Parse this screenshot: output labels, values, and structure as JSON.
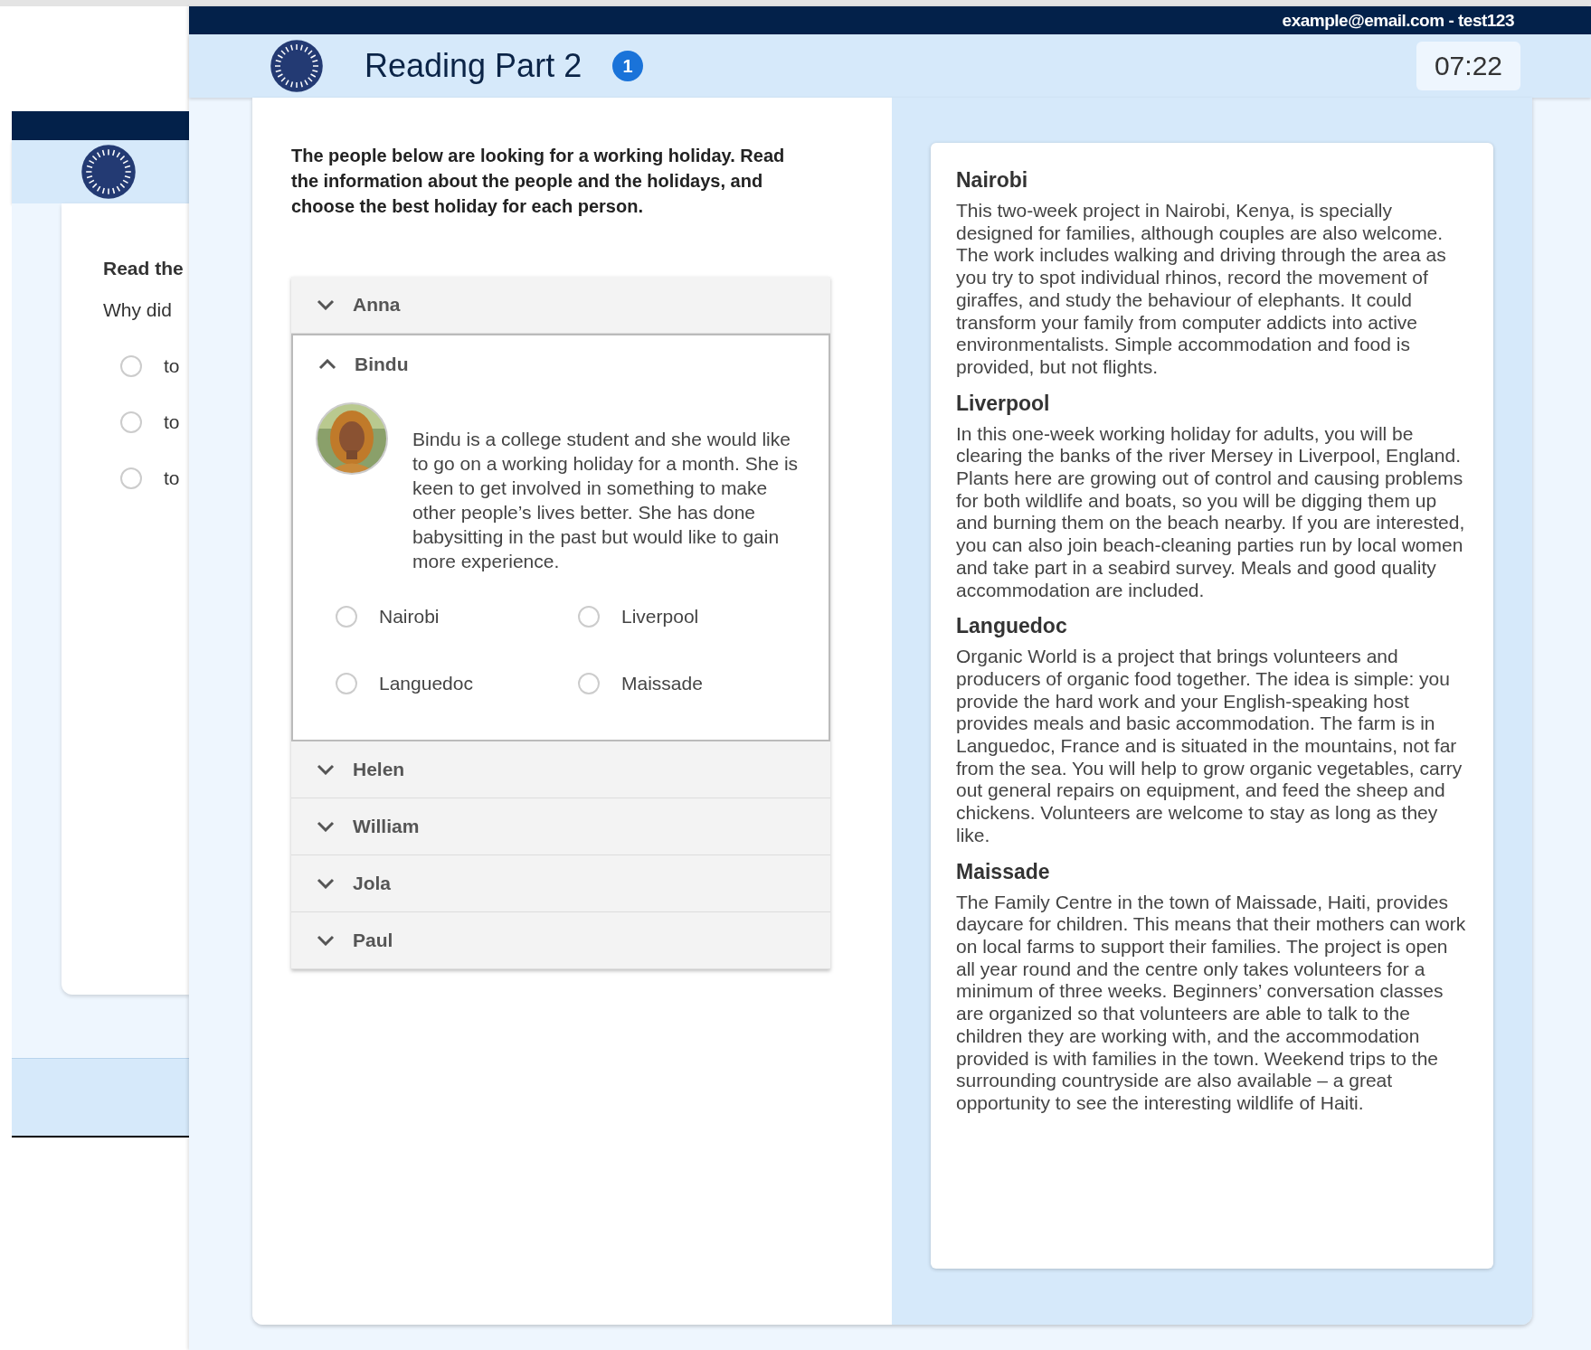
{
  "background_window": {
    "heading": "Read the",
    "question": "Why did",
    "options": [
      {
        "label": "to",
        "selected": false
      },
      {
        "label": "to",
        "selected": false
      },
      {
        "label": "to",
        "selected": false
      }
    ]
  },
  "header": {
    "account": "example@email.com - test123",
    "title": "Reading Part 2",
    "badge": "1",
    "timer": "07:22"
  },
  "instructions": "The people below are looking for a working holiday. Read the information about the people and the holidays, and choose the best holiday for each person.",
  "people": [
    {
      "name": "Anna",
      "expanded": false
    },
    {
      "name": "Bindu",
      "expanded": true,
      "description": "Bindu is a college student and she would like to go on a working holiday for a month. She is keen to get involved in something to make other people’s lives better. She has done babysitting in the past but would like to gain more experience.",
      "options": [
        {
          "label": "Nairobi",
          "selected": false
        },
        {
          "label": "Liverpool",
          "selected": false
        },
        {
          "label": "Languedoc",
          "selected": false
        },
        {
          "label": "Maissade",
          "selected": false
        }
      ]
    },
    {
      "name": "Helen",
      "expanded": false
    },
    {
      "name": "William",
      "expanded": false
    },
    {
      "name": "Jola",
      "expanded": false
    },
    {
      "name": "Paul",
      "expanded": false
    }
  ],
  "holidays": [
    {
      "title": "Nairobi",
      "text": "This two-week project in Nairobi, Kenya, is specially designed for families, although couples are also welcome. The work includes walking and driving through the area as you try to spot individual rhinos, record the movement of giraffes, and study the behaviour of elephants. It could transform your family from computer addicts into active environmentalists. Simple accommodation and food is provided, but not flights."
    },
    {
      "title": "Liverpool",
      "text": "In this one-week working holiday for adults, you will be clearing the banks of the river Mersey in Liverpool, England. Plants here are growing out of control and causing problems for both wildlife and boats, so you will be digging them up and burning them on the beach nearby. If you are interested, you can also join beach-cleaning parties run by local women and take part in a seabird survey. Meals and good quality accommodation are included."
    },
    {
      "title": "Languedoc",
      "text": "Organic World is a project that brings volunteers and producers of organic food together. The idea is simple: you provide the hard work and your English-speaking host provides meals and basic accommodation. The farm is in Languedoc, France and is situated in the mountains, not far from the sea. You will help to grow organic vegetables, carry out general repairs on equipment, and feed the sheep and chickens. Volunteers are welcome to stay as long as they like."
    },
    {
      "title": "Maissade",
      "text": "The Family Centre in the town of Maissade, Haiti, provides daycare for children. This means that their mothers can work on local farms to support their families. The project is open all year round and the centre only takes volunteers for a minimum of three weeks. Beginners’ conversation classes are organized so that volunteers are able to talk to the children they are working with, and the accommodation provided is with families in the town. Weekend trips to the surrounding countryside are also available – a great opportunity to see the interesting wildlife of Haiti."
    }
  ]
}
